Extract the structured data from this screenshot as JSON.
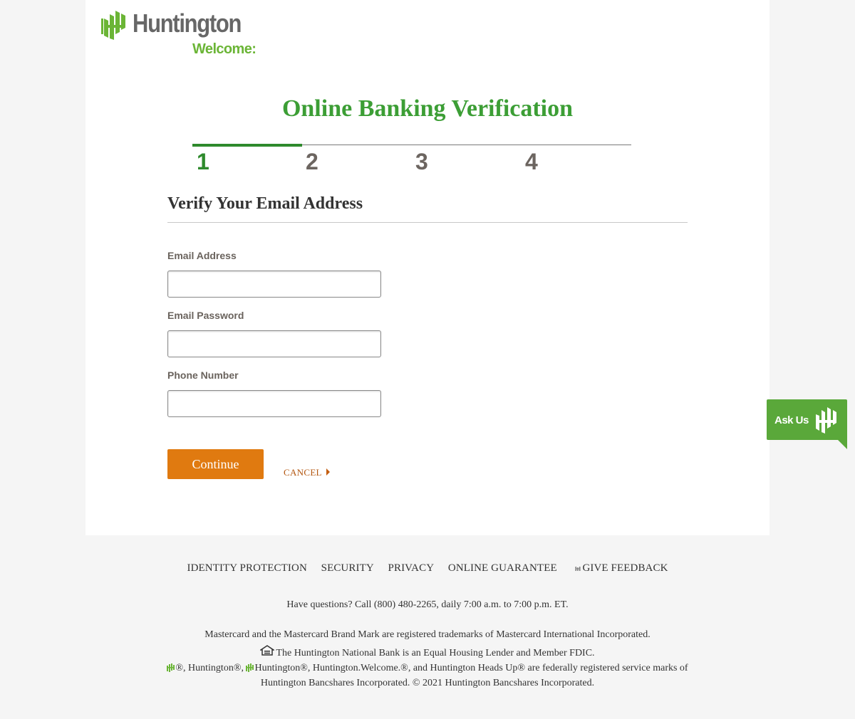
{
  "brand": {
    "name": "Huntington",
    "tagline": "Welcome:",
    "logo_icon": "huntington-logo-icon",
    "colors": {
      "green": "#3c9e35",
      "brand_green": "#6bb536",
      "orange": "#e07a10",
      "gray": "#676767"
    }
  },
  "page": {
    "title": "Online Banking Verification"
  },
  "steps": {
    "current": 1,
    "items": [
      "1",
      "2",
      "3",
      "4"
    ]
  },
  "form": {
    "section_title": "Verify Your Email Address",
    "email_label": "Email Address",
    "email_value": "",
    "password_label": "Email Password",
    "password_value": "",
    "phone_label": "Phone Number",
    "phone_value": "",
    "continue_label": "Continue",
    "cancel_label": "CANCEL"
  },
  "footer": {
    "links": [
      "IDENTITY PROTECTION",
      "SECURITY",
      "PRIVACY",
      "ONLINE GUARANTEE",
      "GIVE FEEDBACK"
    ],
    "questions": "Have questions? Call (800) 480-2265, daily 7:00 a.m. to 7:00 p.m. ET.",
    "mastercard": "Mastercard and the Mastercard Brand Mark are registered trademarks of Mastercard International Incorporated.",
    "fdic": "The Huntington National Bank is an Equal Housing Lender and Member FDIC.",
    "service_marks_a": "®, Huntington®, ",
    "service_marks_b": "Huntington®, Huntington.Welcome.®, and Huntington Heads Up® are federally registered service marks of",
    "service_marks_c": "Huntington Bancshares Incorporated. © 2021 Huntington Bancshares Incorporated."
  },
  "ask_us": {
    "label": "Ask Us",
    "icon": "huntington-logo-icon"
  }
}
